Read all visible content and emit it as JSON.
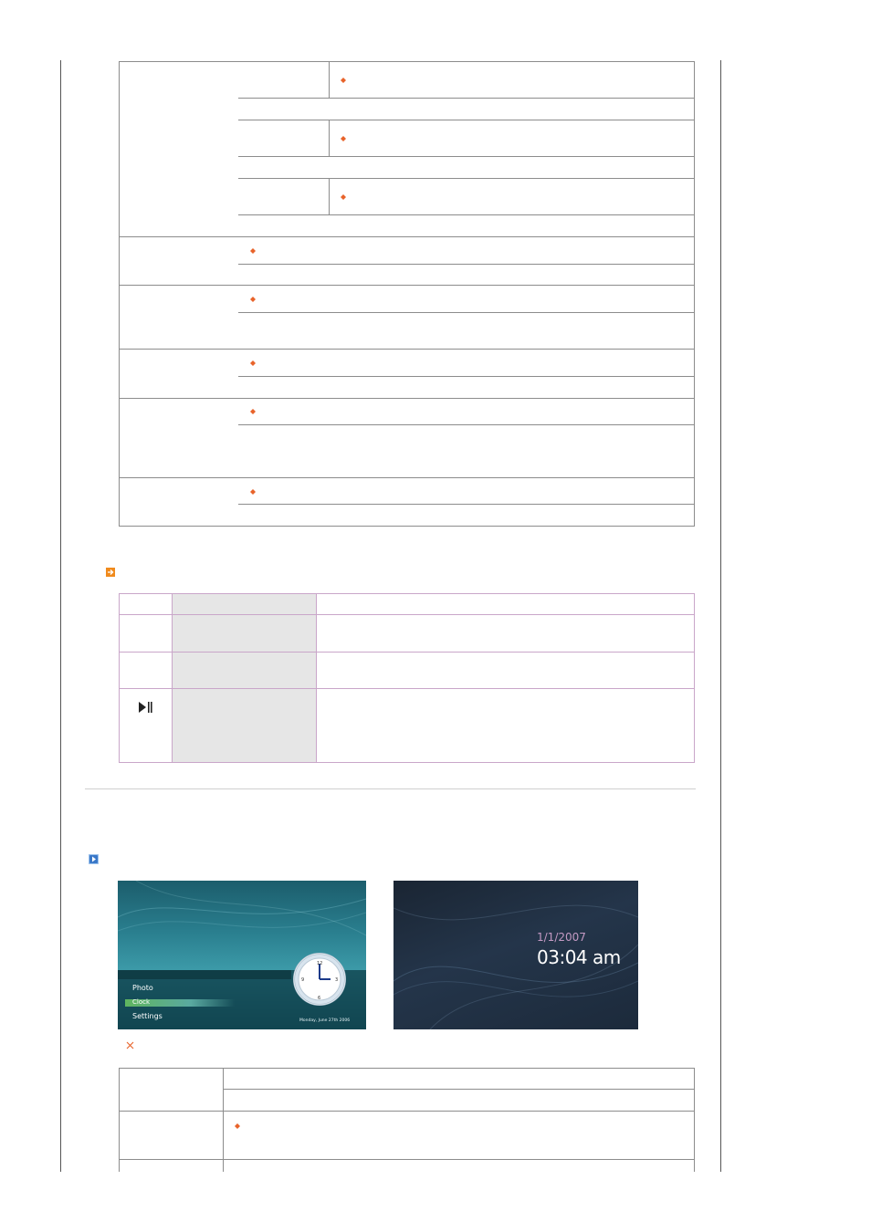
{
  "page": {
    "colors": {
      "bullet": "#e8632a",
      "table_border": "#8c8c8c",
      "purple_border": "#c9a6c9",
      "gray_fill": "#e6e6e6",
      "arrow_icon": "#f08a1c",
      "play_icon": "#3a78c8"
    }
  },
  "button_table": {
    "play_pause_icon": "play-pause-icon"
  },
  "screenshots": {
    "menu_screen": {
      "items": [
        "Photo",
        "Clock",
        "Settings"
      ],
      "selected": "Clock",
      "footer_date": "Monday, June 27th 2006"
    },
    "clock_screen": {
      "date": "1/1/2007",
      "time": "03:04 am"
    }
  },
  "icons": {
    "section_arrow": "arrow-right-icon",
    "section_play": "play-right-icon",
    "note_mark": "note-x-icon",
    "bullet": "diamond-bullet-icon"
  }
}
